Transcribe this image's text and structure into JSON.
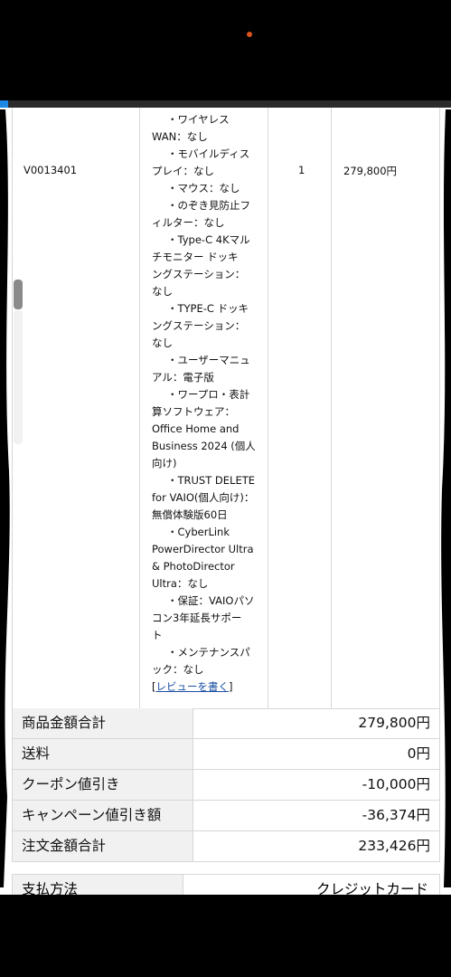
{
  "item": {
    "code": "V0013401",
    "quantity": "1",
    "price": "279,800円",
    "spec_lines": [
      {
        "text": "・ワイヤレス",
        "indent": true
      },
      {
        "text": "WAN：なし",
        "indent": false
      },
      {
        "text": "・モバイルディス",
        "indent": true
      },
      {
        "text": "プレイ：なし",
        "indent": false
      },
      {
        "text": "・マウス：なし",
        "indent": true
      },
      {
        "text": "・のぞき見防止フ",
        "indent": true
      },
      {
        "text": "ィルター：なし",
        "indent": false
      },
      {
        "text": "・Type-C 4Kマル",
        "indent": true
      },
      {
        "text": "チモニター ドッキ",
        "indent": false
      },
      {
        "text": "ングステーション：",
        "indent": false
      },
      {
        "text": "なし",
        "indent": false
      },
      {
        "text": "・TYPE-C ドッキ",
        "indent": true
      },
      {
        "text": "ングステーション：",
        "indent": false
      },
      {
        "text": "なし",
        "indent": false
      },
      {
        "text": "・ユーザーマニュ",
        "indent": true
      },
      {
        "text": "アル：電子版",
        "indent": false
      },
      {
        "text": "・ワープロ・表計",
        "indent": true
      },
      {
        "text": "算ソフトウェア：",
        "indent": false
      },
      {
        "text": "Office Home and",
        "indent": false
      },
      {
        "text": "Business 2024 (個人",
        "indent": false
      },
      {
        "text": "向け)",
        "indent": false
      },
      {
        "text": "・TRUST DELETE",
        "indent": true
      },
      {
        "text": "for VAIO(個人向け)：",
        "indent": false
      },
      {
        "text": "無償体験版60日",
        "indent": false
      },
      {
        "text": "・CyberLink",
        "indent": true
      },
      {
        "text": "PowerDirector Ultra",
        "indent": false
      },
      {
        "text": "& PhotoDirector",
        "indent": false
      },
      {
        "text": "Ultra：なし",
        "indent": false
      },
      {
        "text": "・保証：VAIOパソ",
        "indent": true
      },
      {
        "text": "コン3年延長サポー",
        "indent": false
      },
      {
        "text": "ト",
        "indent": false
      },
      {
        "text": "・メンテナンスパ",
        "indent": true
      },
      {
        "text": "ック：なし",
        "indent": false
      }
    ],
    "review_open": "[",
    "review_link": "レビューを書く",
    "review_close": "]"
  },
  "summary": [
    {
      "label": "商品金額合計",
      "value": "279,800円"
    },
    {
      "label": "送料",
      "value": "0円"
    },
    {
      "label": "クーポン値引き",
      "value": "-10,000円"
    },
    {
      "label": "キャンペーン値引き額",
      "value": "-36,374円"
    },
    {
      "label": "注文金額合計",
      "value": "233,426円"
    }
  ],
  "payment": {
    "label": "支払方法",
    "value": "クレジットカード"
  },
  "colors": {
    "link": "#1a4fa3",
    "label_bg": "#f1f1f1",
    "border": "#d7d7d7",
    "accent": "#1e88e5"
  }
}
